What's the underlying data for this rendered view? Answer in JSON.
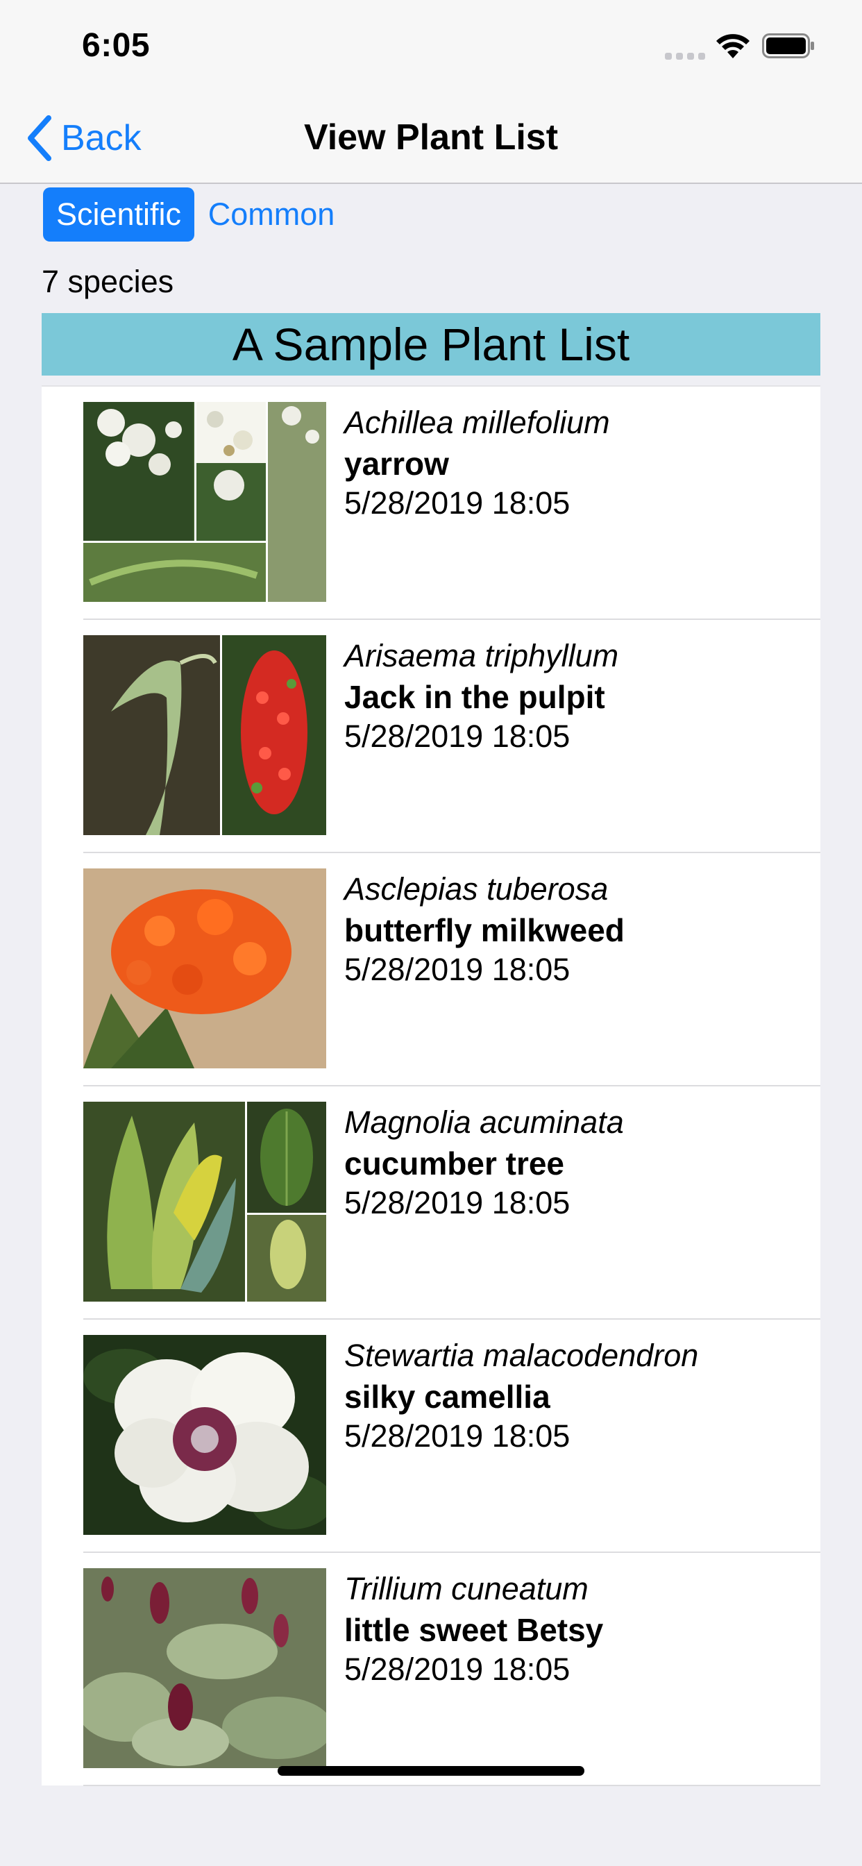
{
  "status_bar": {
    "time": "6:05"
  },
  "nav": {
    "back_label": "Back",
    "title": "View Plant List"
  },
  "sort_toggle": {
    "options": [
      "Scientific",
      "Common"
    ],
    "selected": "Scientific"
  },
  "species_count": "7 species",
  "list_title": "A Sample Plant List",
  "colors": {
    "accent": "#147efb",
    "header_band": "#7bc8d8",
    "background": "#efeff4"
  },
  "plants": [
    {
      "scientific": "Achillea millefolium",
      "common": "yarrow",
      "date": "5/28/2019 18:05"
    },
    {
      "scientific": "Arisaema triphyllum",
      "common": "Jack in the pulpit",
      "date": "5/28/2019 18:05"
    },
    {
      "scientific": "Asclepias tuberosa",
      "common": "butterfly milkweed",
      "date": "5/28/2019 18:05"
    },
    {
      "scientific": "Magnolia acuminata",
      "common": "cucumber tree",
      "date": "5/28/2019 18:05"
    },
    {
      "scientific": "Stewartia malacodendron",
      "common": "silky camellia",
      "date": "5/28/2019 18:05"
    },
    {
      "scientific": "Trillium cuneatum",
      "common": "little sweet Betsy",
      "date": "5/28/2019 18:05"
    }
  ]
}
